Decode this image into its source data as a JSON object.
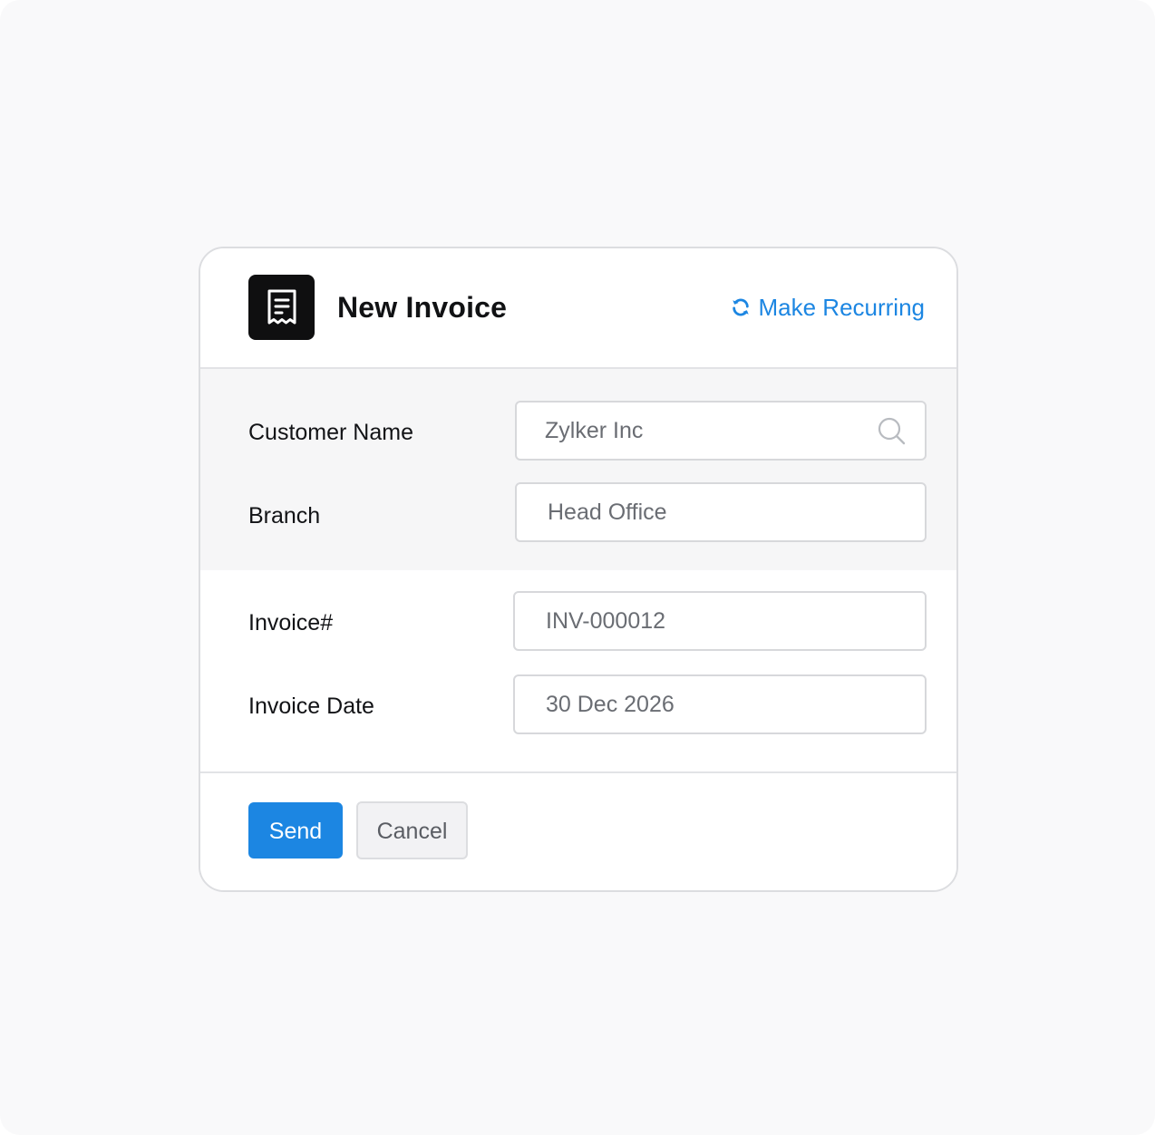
{
  "header": {
    "title": "New Invoice",
    "app_icon": "receipt-icon",
    "recurring_label": "Make Recurring",
    "recurring_icon": "refresh-icon"
  },
  "form": {
    "customer": {
      "label": "Customer Name",
      "value": "Zylker Inc",
      "icon": "search-icon"
    },
    "branch": {
      "label": "Branch",
      "value": "Head Office"
    },
    "invoice_number": {
      "label": "Invoice#",
      "value": "INV-000012"
    },
    "invoice_date": {
      "label": "Invoice Date",
      "value": "30 Dec 2026"
    }
  },
  "actions": {
    "send_label": "Send",
    "cancel_label": "Cancel"
  },
  "colors": {
    "accent": "#1c86e2",
    "app_icon_bg": "#0f0f10",
    "section_bg": "#f6f6f7"
  }
}
